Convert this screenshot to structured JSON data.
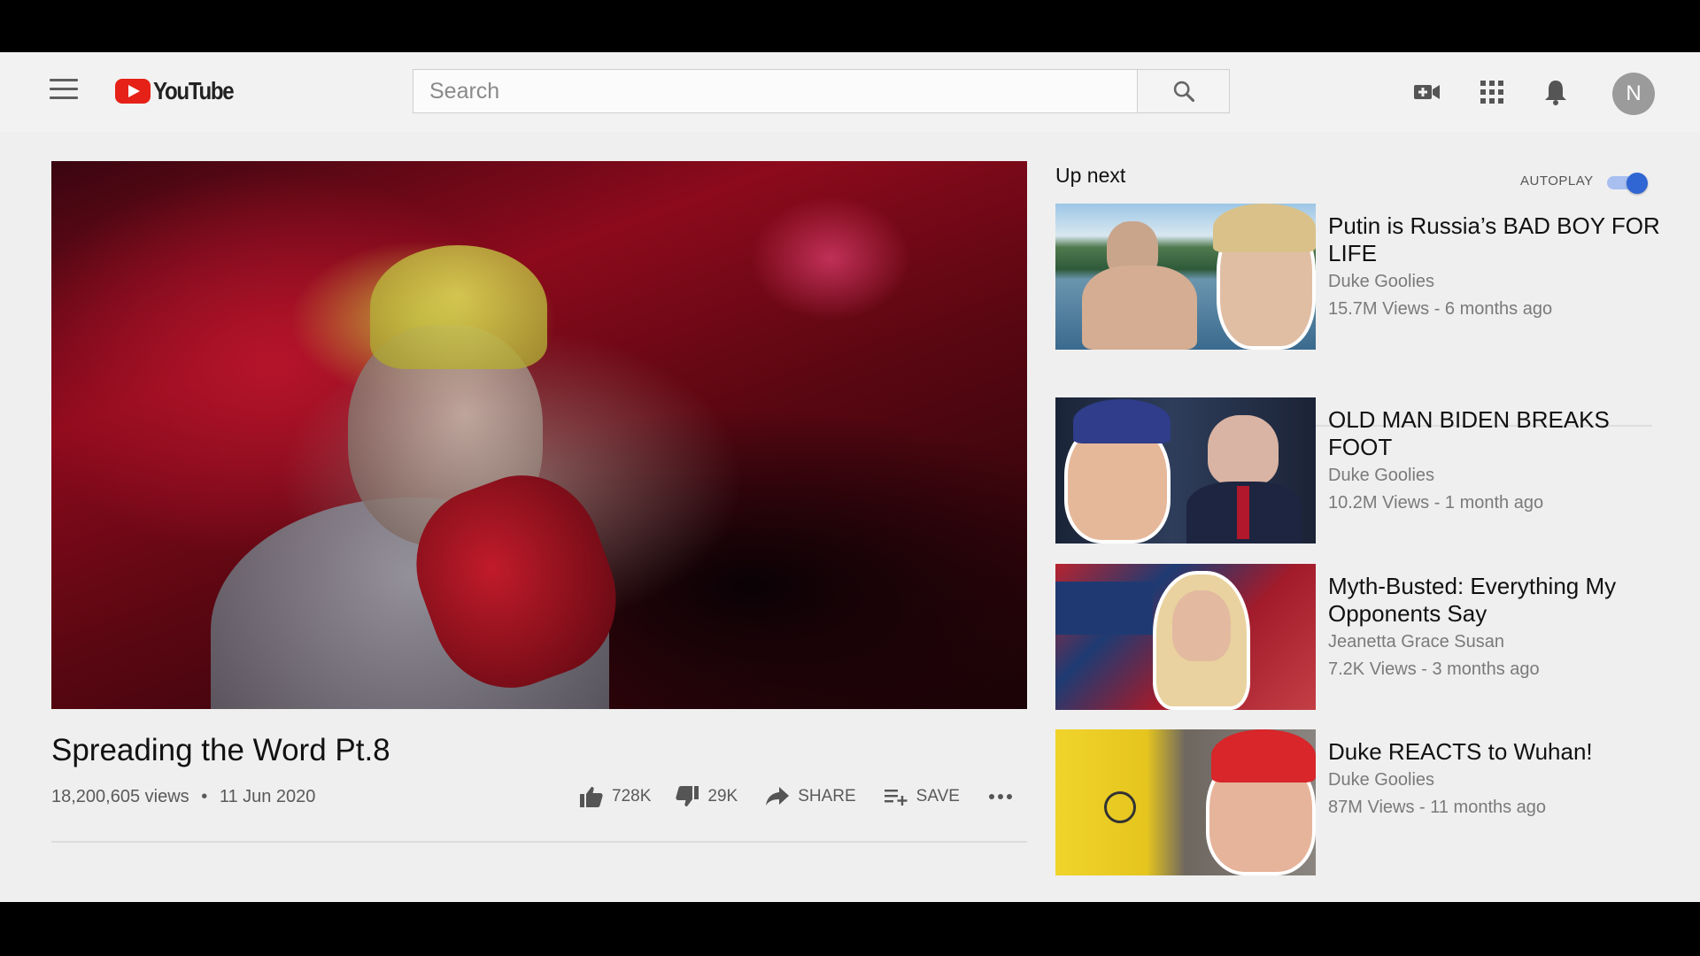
{
  "header": {
    "logo_text": "YouTube",
    "search_placeholder": "Search",
    "avatar_letter": "N",
    "icons": [
      "menu-icon",
      "youtube-logo",
      "search-icon",
      "create-video-icon",
      "apps-grid-icon",
      "notifications-bell-icon"
    ]
  },
  "video": {
    "title": "Spreading the Word Pt.8",
    "views": "18,200,605 views",
    "date": "11 Jun 2020",
    "likes": "728K",
    "dislikes": "29K",
    "share_label": "SHARE",
    "save_label": "SAVE"
  },
  "sidebar": {
    "up_next_label": "Up next",
    "autoplay_label": "AUTOPLAY",
    "autoplay_on": true,
    "recommendations": [
      {
        "title": "Putin is Russia’s BAD BOY FOR LIFE",
        "channel": "Duke Goolies",
        "meta": "15.7M Views - 6 months ago"
      },
      {
        "title": "OLD MAN BIDEN BREAKS FOOT",
        "channel": "Duke Goolies",
        "meta": "10.2M Views - 1 month ago"
      },
      {
        "title": "Myth-Busted: Everything My Opponents Say",
        "channel": "Jeanetta Grace Susan",
        "meta": "7.2K Views - 3 months ago"
      },
      {
        "title": "Duke REACTS to Wuhan!",
        "channel": "Duke Goolies",
        "meta": "87M Views - 11 months ago"
      }
    ]
  },
  "colors": {
    "brand_red": "#e62117",
    "toggle_blue": "#2f66d4",
    "page_bg": "#efefef"
  }
}
